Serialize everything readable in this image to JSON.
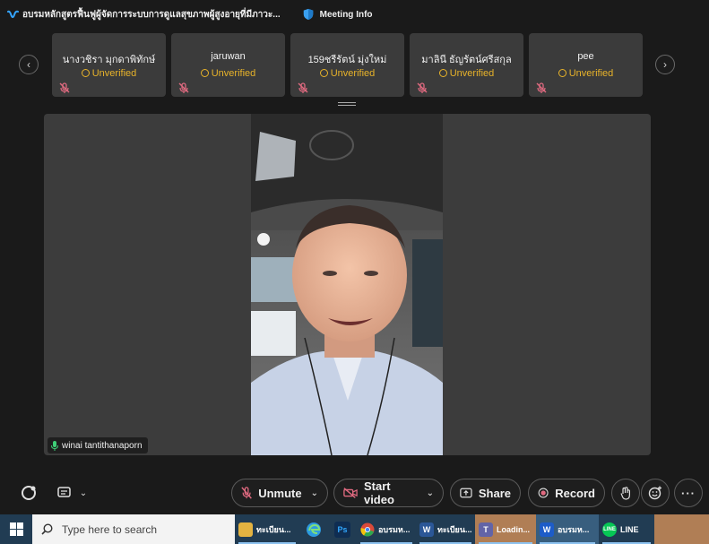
{
  "window": {
    "title": "อบรมหลักสูตรฟื้นฟูผู้จัดการระบบการดูแลสุขภาพผู้สูงอายุที่มีภาวะ...",
    "meeting_info": "Meeting Info"
  },
  "participants": [
    {
      "name": "นางวชิรา มุกดาพิทักษ์",
      "status": "Unverified"
    },
    {
      "name": "jaruwan",
      "status": "Unverified"
    },
    {
      "name": "159ชรีรัตน์  มุ่งใหม่",
      "status": "Unverified"
    },
    {
      "name": "มาลินี ธัญรัตน์ศรีสกุล",
      "status": "Unverified"
    },
    {
      "name": "pee",
      "status": "Unverified"
    }
  ],
  "active_speaker": {
    "name": "winai tantithanaporn"
  },
  "controls": {
    "unmute": "Unmute",
    "start_video": "Start video",
    "share": "Share",
    "record": "Record"
  },
  "taskbar": {
    "search_placeholder": "Type here to search",
    "items": [
      {
        "label": "ทะเบียน...",
        "icon": "folder-icon",
        "color": "#e3b341"
      },
      {
        "label": "",
        "icon": "edge-icon",
        "color": "#2d9be0"
      },
      {
        "label": "",
        "icon": "photoshop-icon",
        "color": "#0f2d52"
      },
      {
        "label": "อบรมห...",
        "icon": "chrome-icon",
        "color": "#d94a3a"
      },
      {
        "label": "ทะเบียน...",
        "icon": "word-icon",
        "color": "#2b5797"
      },
      {
        "label": "Loadin...",
        "icon": "teams-icon",
        "color": "#6264a7"
      },
      {
        "label": "อบรมห...",
        "icon": "webex-icon",
        "color": "#1d5cc8"
      },
      {
        "label": "LINE",
        "icon": "line-icon",
        "color": "#06c755"
      }
    ]
  },
  "colors": {
    "background": "#1a1a1a",
    "tile": "#3b3b3b",
    "unverified": "#e8b32a",
    "muted_red": "#e06a80",
    "taskbar": "#213c53"
  }
}
